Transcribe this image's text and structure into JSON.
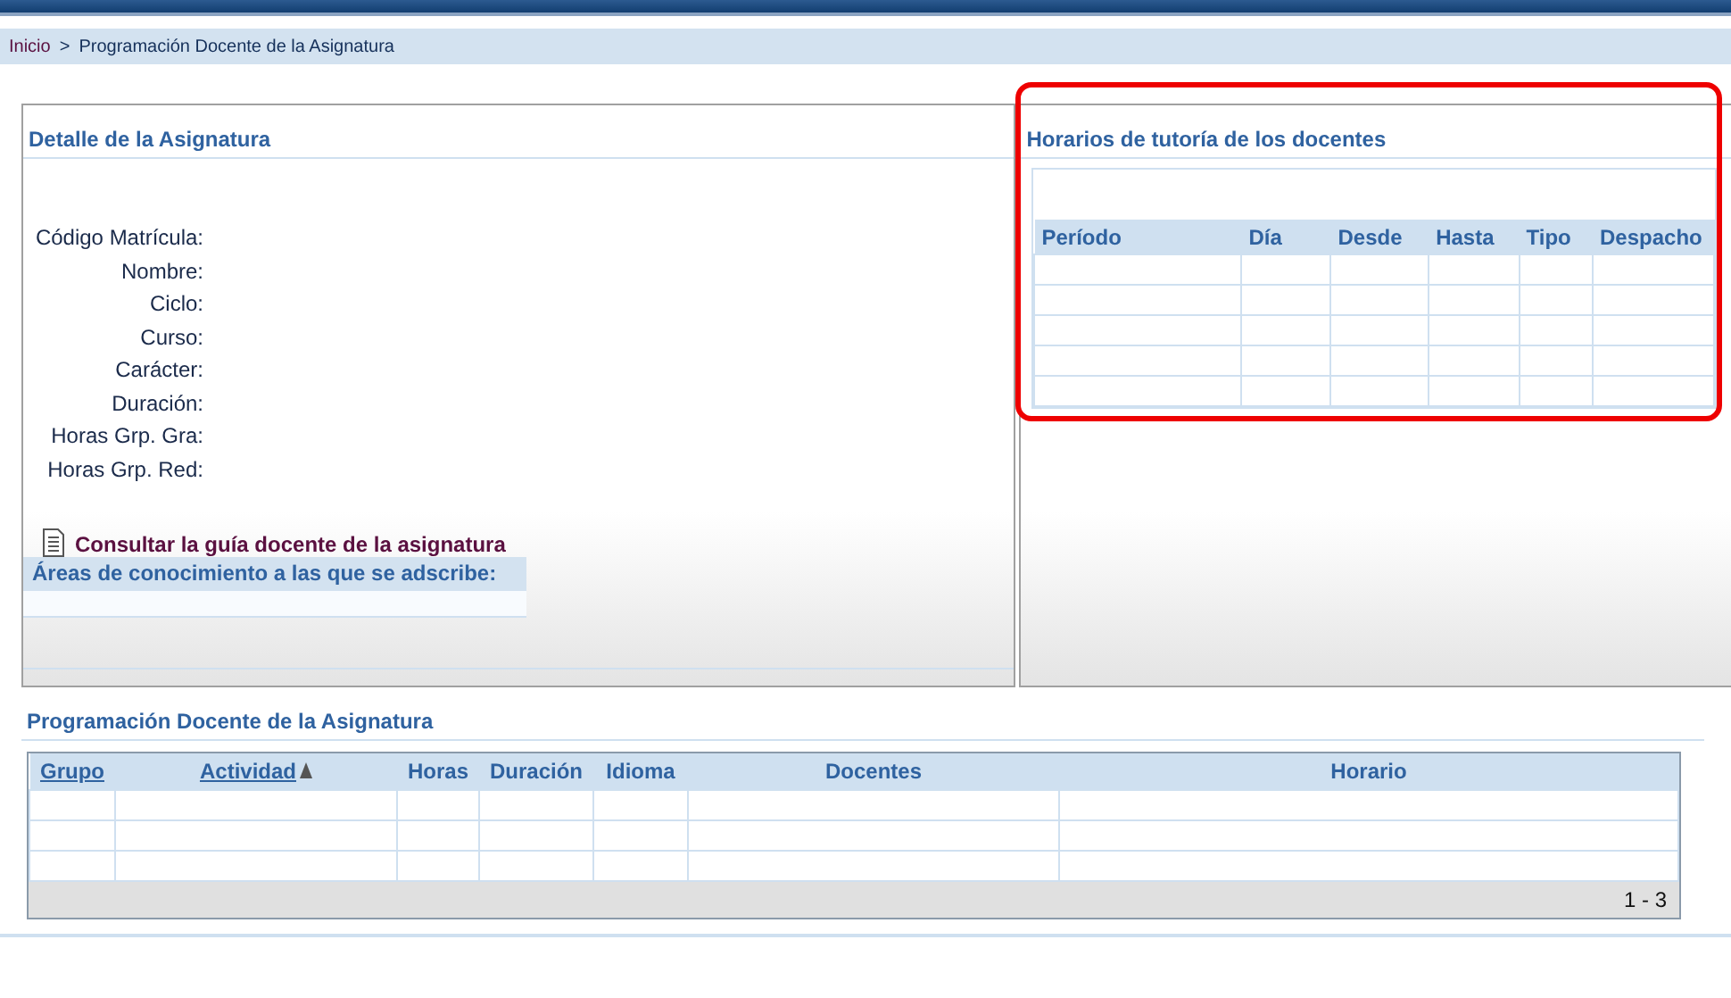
{
  "breadcrumb": [
    {
      "label": "Inicio",
      "kind": "link"
    },
    {
      "label": ">",
      "kind": "separator"
    },
    {
      "label": "Programación Docente de la Asignatura",
      "kind": "current"
    }
  ],
  "detail": {
    "title": "Detalle de la Asignatura",
    "fields": [
      "Código Matrícula:",
      "Nombre:",
      "Ciclo:",
      "Curso:",
      "Carácter:",
      "Duración:",
      "Horas Grp. Gra:",
      "Horas Grp. Red:"
    ],
    "guide_link": "Consultar la guía docente de la asignatura",
    "areas_title": "Áreas de conocimiento a las que se adscribe:"
  },
  "tutoring": {
    "title": "Horarios de tutoría de los docentes",
    "highlighted": true,
    "columns": [
      "Período",
      "Día",
      "Desde",
      "Hasta",
      "Tipo",
      "Despacho"
    ],
    "rows": [
      {},
      {},
      {},
      {},
      {}
    ]
  },
  "programming": {
    "title": "Programación Docente de la Asignatura",
    "columns": [
      {
        "label": "Grupo",
        "link": true,
        "sorted": false
      },
      {
        "label": "Actividad",
        "link": true,
        "sorted": true
      },
      {
        "label": "Horas",
        "link": false,
        "sorted": false
      },
      {
        "label": "Duración",
        "link": false,
        "sorted": false
      },
      {
        "label": "Idioma",
        "link": false,
        "sorted": false
      },
      {
        "label": "Docentes",
        "link": false,
        "sorted": false
      },
      {
        "label": "Horario",
        "link": false,
        "sorted": false
      }
    ],
    "rows": [
      {},
      {},
      {}
    ],
    "pager": "1 - 3"
  }
}
